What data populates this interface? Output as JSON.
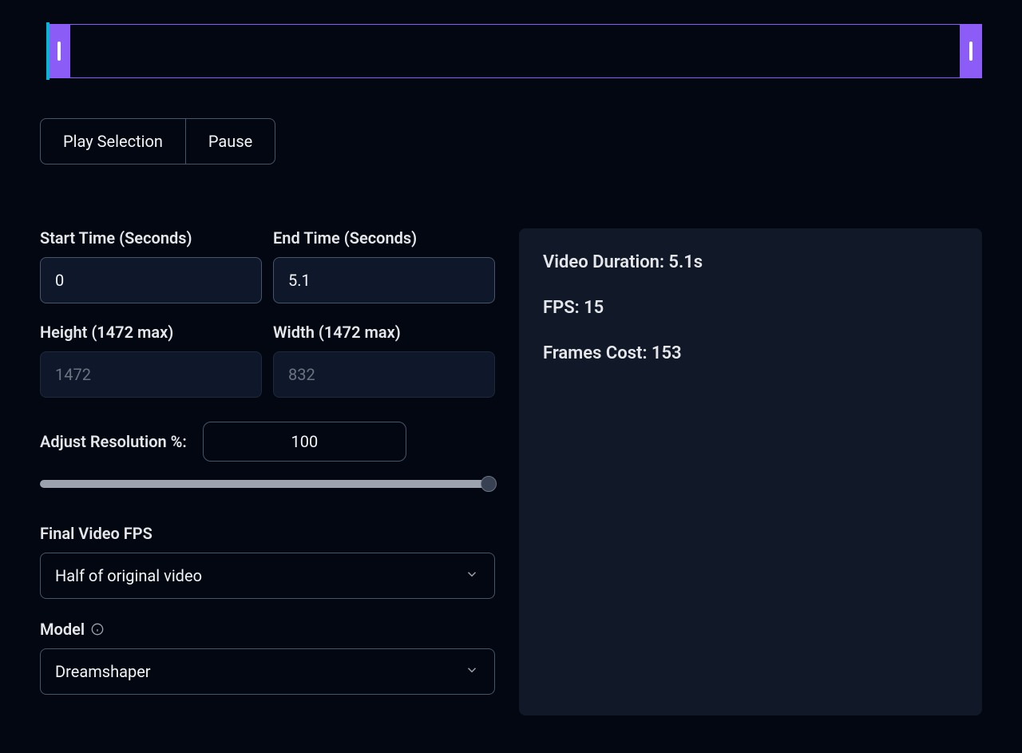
{
  "timeline": {
    "play_label": "Play Selection",
    "pause_label": "Pause"
  },
  "fields": {
    "start_time": {
      "label": "Start Time (Seconds)",
      "value": "0"
    },
    "end_time": {
      "label": "End Time (Seconds)",
      "value": "5.1"
    },
    "height": {
      "label": "Height (1472 max)",
      "value": "1472"
    },
    "width": {
      "label": "Width (1472 max)",
      "value": "832"
    },
    "resolution": {
      "label": "Adjust Resolution %:",
      "value": "100"
    },
    "fps_select": {
      "label": "Final Video FPS",
      "value": "Half of original video"
    },
    "model_select": {
      "label": "Model",
      "value": "Dreamshaper"
    }
  },
  "stats": {
    "duration": "Video Duration: 5.1s",
    "fps": "FPS: 15",
    "frames_cost": "Frames Cost: 153"
  }
}
